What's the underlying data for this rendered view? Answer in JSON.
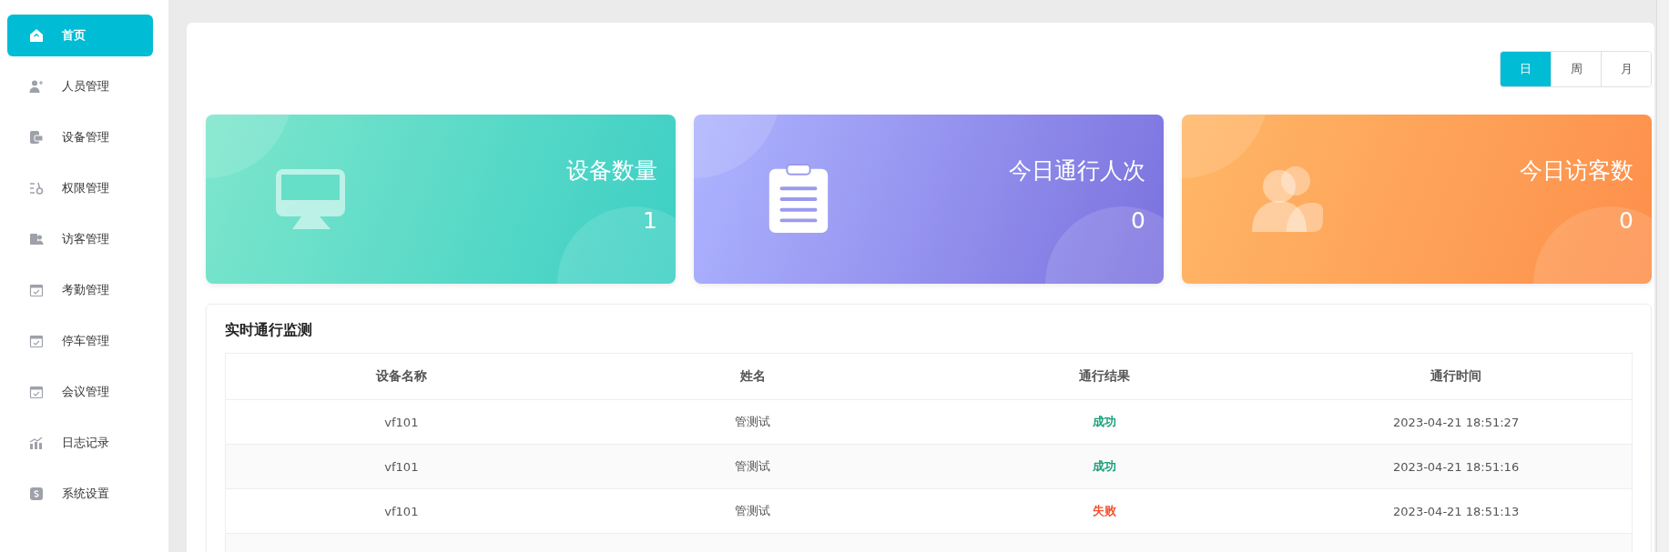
{
  "sidebar": {
    "items": [
      {
        "label": "首页",
        "selected": true
      },
      {
        "label": "人员管理",
        "selected": false
      },
      {
        "label": "设备管理",
        "selected": false
      },
      {
        "label": "权限管理",
        "selected": false
      },
      {
        "label": "访客管理",
        "selected": false
      },
      {
        "label": "考勤管理",
        "selected": false
      },
      {
        "label": "停车管理",
        "selected": false
      },
      {
        "label": "会议管理",
        "selected": false
      },
      {
        "label": "日志记录",
        "selected": false
      },
      {
        "label": "系统设置",
        "selected": false
      }
    ]
  },
  "period_tabs": [
    {
      "label": "日",
      "selected": true
    },
    {
      "label": "周",
      "selected": false
    },
    {
      "label": "月",
      "selected": false
    }
  ],
  "stat_cards": [
    {
      "kind": "device",
      "title": "设备数量",
      "value": "1"
    },
    {
      "kind": "pass",
      "title": "今日通行人次",
      "value": "0"
    },
    {
      "kind": "visitor",
      "title": "今日访客数",
      "value": "0"
    }
  ],
  "monitor": {
    "title": "实时通行监测",
    "table": {
      "columns": [
        "设备名称",
        "姓名",
        "通行结果",
        "通行时间"
      ],
      "rows": [
        {
          "device": "vf101",
          "name": "管测试",
          "result": "成功",
          "color": "#1aa07c",
          "time": "2023-04-21 18:51:27"
        },
        {
          "device": "vf101",
          "name": "管测试",
          "result": "成功",
          "color": "#1aa07c",
          "time": "2023-04-21 18:51:16"
        },
        {
          "device": "vf101",
          "name": "管测试",
          "result": "失败",
          "color": "#f5522d",
          "time": "2023-04-21 18:51:13"
        }
      ]
    }
  }
}
